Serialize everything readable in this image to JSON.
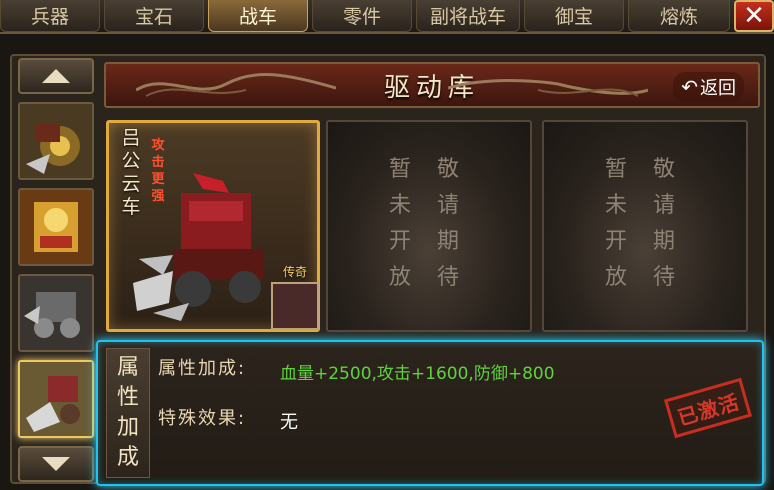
{
  "tabs": [
    {
      "label": "兵器",
      "active": false
    },
    {
      "label": "宝石",
      "active": false
    },
    {
      "label": "战车",
      "active": true
    },
    {
      "label": "零件",
      "active": false
    },
    {
      "label": "副将战车",
      "active": false
    },
    {
      "label": "御宝",
      "active": false
    },
    {
      "label": "熔炼",
      "active": false
    }
  ],
  "close_label": "✕",
  "title": "驱动库",
  "back_label": "返回",
  "selected_car": {
    "name": "吕公云车",
    "tag": "攻击更强",
    "rarity": "传奇"
  },
  "empty_slot_lines": [
    [
      "暂",
      "敬"
    ],
    [
      "未",
      "请"
    ],
    [
      "开",
      "期"
    ],
    [
      "放",
      "待"
    ]
  ],
  "attr_panel": {
    "side_title": [
      "属",
      "性",
      "加",
      "成"
    ],
    "bonus_label": "属性加成:",
    "bonus_value": "血量+2500,攻击+1600,防御+800",
    "special_label": "特殊效果:",
    "special_value": "无",
    "stamp": "已激活"
  },
  "colors": {
    "accent_green": "#5ed43a",
    "highlight_cyan": "#1ec3f0",
    "stamp_red": "#c82e20"
  }
}
